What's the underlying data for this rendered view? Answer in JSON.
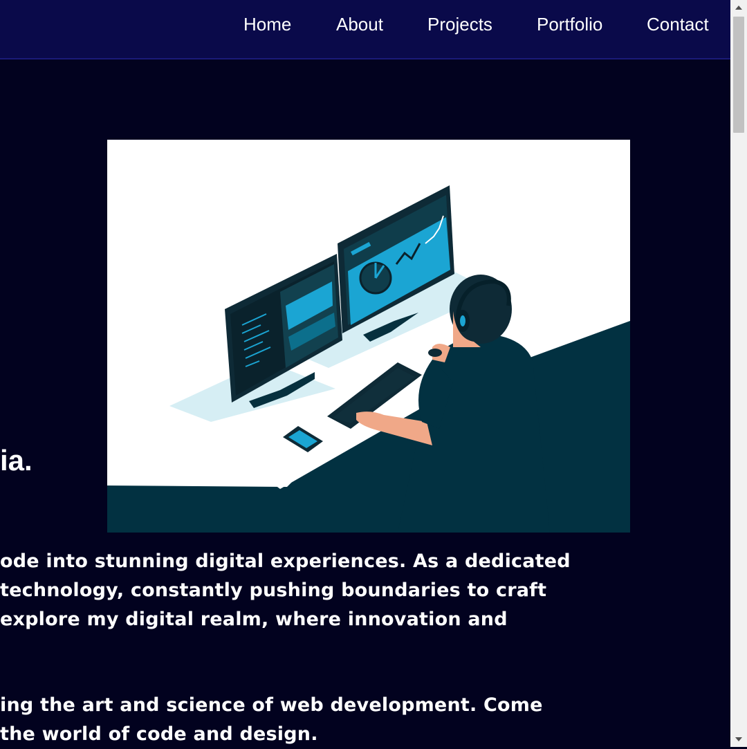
{
  "nav": {
    "items": [
      {
        "label": "Home"
      },
      {
        "label": "About"
      },
      {
        "label": "Projects"
      },
      {
        "label": "Portfolio"
      },
      {
        "label": "Contact"
      }
    ]
  },
  "hero": {
    "heading_fragment": "ia.",
    "paragraph1": [
      "ode into stunning digital experiences. As a dedicated",
      "technology, constantly pushing boundaries to craft",
      "explore my digital realm, where innovation and"
    ],
    "paragraph2": [
      "ing the art and science of web development. Come",
      "the world of code and design."
    ]
  },
  "colors": {
    "page_bg": "#02021f",
    "navbar_bg": "#0a0a4a",
    "illustration_dark": "#023141",
    "illustration_accent": "#1ba5d3"
  },
  "icons": {
    "illustration": "developer-at-desk-illustration",
    "scroll_up": "scroll-up-arrow-icon",
    "scroll_down": "scroll-down-arrow-icon"
  }
}
